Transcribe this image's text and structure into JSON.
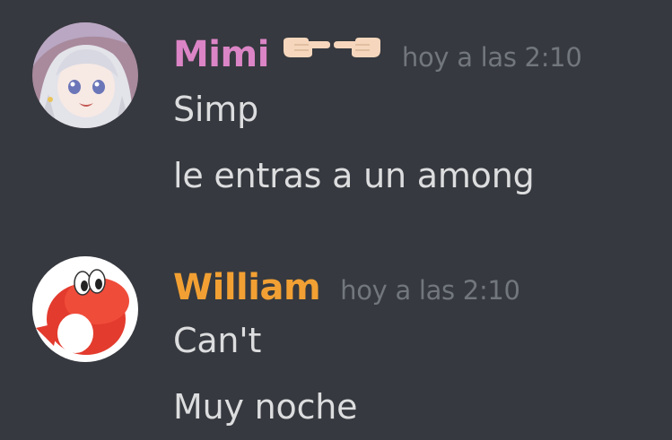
{
  "messages": [
    {
      "username": "Mimi",
      "username_color": "#db85c6",
      "name_emoji": [
        "pointing-right-hand-emoji",
        "pointing-left-hand-emoji"
      ],
      "timestamp": "hoy a las 2:10",
      "lines": [
        "Simp",
        "le entras a un among"
      ]
    },
    {
      "username": "William",
      "username_color": "#f2a033",
      "timestamp": "hoy a las 2:10",
      "lines": [
        "Can't",
        "Muy noche"
      ]
    }
  ]
}
